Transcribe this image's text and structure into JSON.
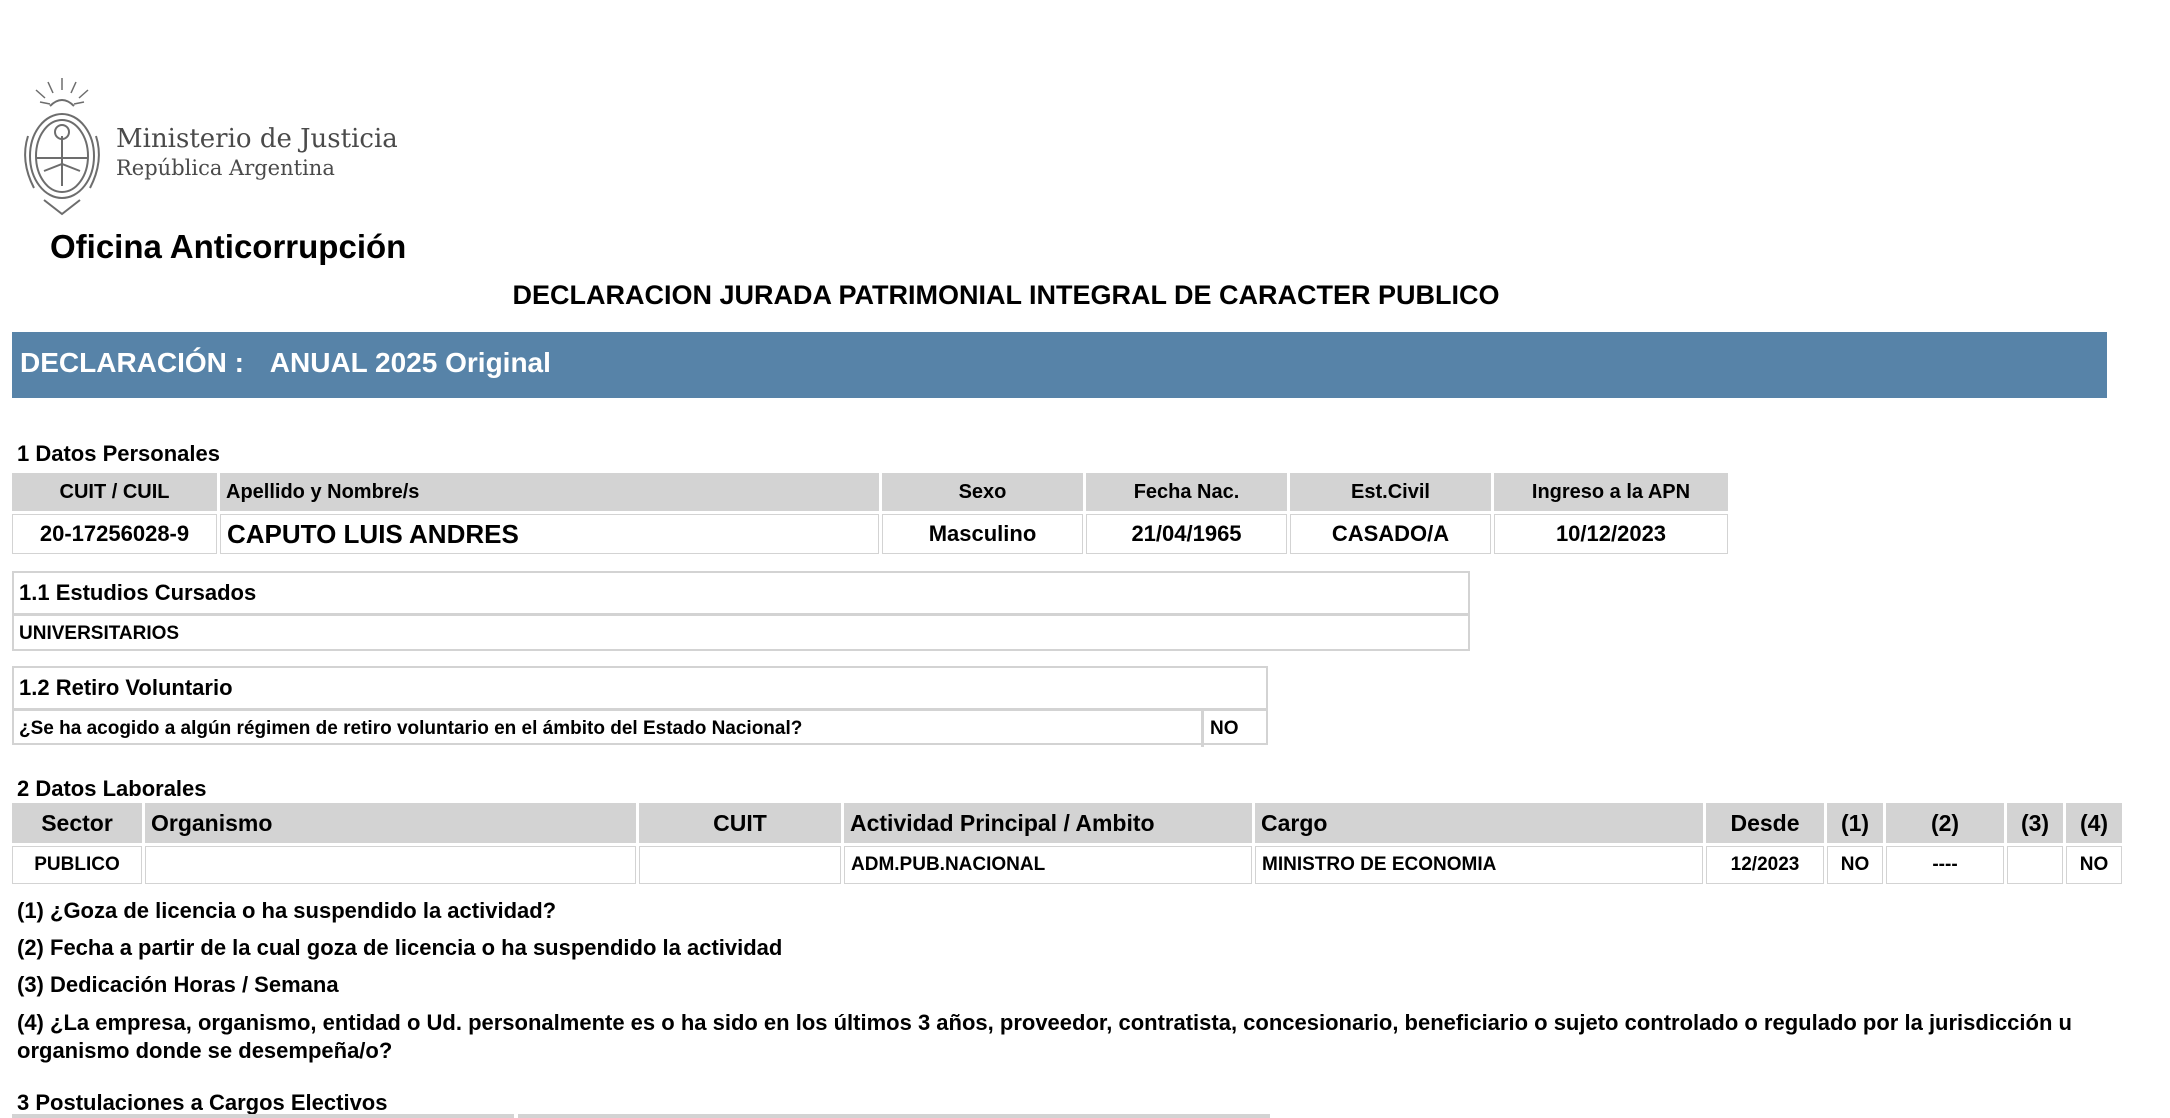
{
  "header": {
    "ministry_line1": "Ministerio de Justicia",
    "ministry_line2": "República Argentina",
    "office": "Oficina Anticorrupción",
    "title": "DECLARACION JURADA PATRIMONIAL INTEGRAL DE CARACTER PUBLICO"
  },
  "declaration": {
    "label": "DECLARACIÓN :",
    "value": "ANUAL 2025 Original"
  },
  "personal": {
    "section": "1 Datos Personales",
    "headers": [
      "CUIT / CUIL",
      "Apellido y Nombre/s",
      "Sexo",
      "Fecha Nac.",
      "Est.Civil",
      "Ingreso a la APN"
    ],
    "row": [
      "20-17256028-9",
      "CAPUTO LUIS ANDRES",
      "Masculino",
      "21/04/1965",
      "CASADO/A",
      "10/12/2023"
    ]
  },
  "studies": {
    "section": "1.1 Estudios Cursados",
    "value": "UNIVERSITARIOS"
  },
  "retirement": {
    "section": "1.2 Retiro Voluntario",
    "question": "¿Se ha acogido a algún régimen de retiro voluntario en el ámbito del Estado Nacional?",
    "answer": "NO"
  },
  "work": {
    "section": "2 Datos Laborales",
    "headers": [
      "Sector",
      "Organismo",
      "CUIT",
      "Actividad Principal / Ambito",
      "Cargo",
      "Desde",
      "(1)",
      "(2)",
      "(3)",
      "(4)"
    ],
    "row": [
      "PUBLICO",
      "",
      "",
      "ADM.PUB.NACIONAL",
      "MINISTRO DE ECONOMIA",
      "12/2023",
      "NO",
      "----",
      "",
      "NO"
    ],
    "notes": [
      "(1) ¿Goza de licencia o ha suspendido la actividad?",
      "(2) Fecha a partir de la cual goza de licencia o ha suspendido la actividad",
      "(3) Dedicación Horas / Semana",
      "(4) ¿La empresa, organismo, entidad o Ud. personalmente es o ha sido en los últimos 3 años, proveedor, contratista, concesionario, beneficiario o sujeto controlado o regulado por la jurisdicción u organismo donde se desempeña/o?"
    ]
  },
  "elective": {
    "section": "3 Postulaciones a Cargos Electivos"
  }
}
